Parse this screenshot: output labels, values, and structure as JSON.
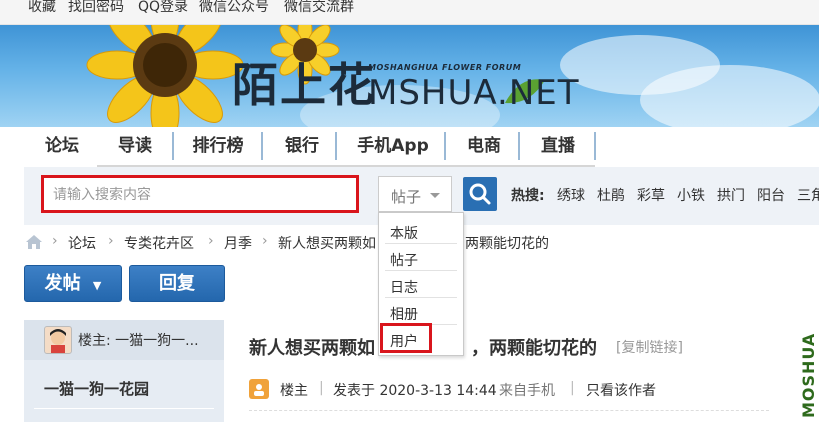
{
  "top_links": [
    "收藏",
    "找回密码",
    "QQ登录",
    "微信公众号",
    "微信交流群"
  ],
  "logo": {
    "chinese": "陌上花",
    "tagline": "MOSHANGHUA FLOWER FORUM",
    "english": "MSHUA.NET"
  },
  "nav": [
    "论坛",
    "导读",
    "排行榜",
    "银行",
    "手机App",
    "电商",
    "直播"
  ],
  "search": {
    "placeholder": "请输入搜索内容",
    "type_selected": "帖子",
    "hot_label": "热搜:",
    "hot_terms": [
      "绣球",
      "杜鹃",
      "彩草",
      "小铁",
      "拱门",
      "阳台",
      "三角"
    ]
  },
  "search_dropdown": [
    "本版",
    "帖子",
    "日志",
    "相册",
    "用户"
  ],
  "breadcrumb": [
    "论坛",
    "专类花卉区",
    "月季",
    "新人想买两颗如",
    "两颗能切花的"
  ],
  "buttons": {
    "post": "发帖",
    "reply": "回复"
  },
  "thread": {
    "op_label": "楼主: 一猫一狗一...",
    "author_name": "一猫一狗一花园",
    "title": "新人想买两颗如          ，两颗能切花的",
    "title_left": "新人想买两颗如",
    "title_right": "，两颗能切花的",
    "copy_link": "[复制链接]",
    "meta_op": "楼主",
    "meta_posted": "发表于 2020-3-13 14:44",
    "meta_source": "来自手机",
    "meta_only_author": "只看该作者"
  },
  "watermark": "MOSHUA",
  "colors": {
    "accent_red": "#d9151c",
    "button_blue": "#2a6fb3"
  },
  "icons": [
    "home-icon",
    "search-icon",
    "dropdown-caret-icon",
    "sunflower-image",
    "author-badge-icon"
  ]
}
